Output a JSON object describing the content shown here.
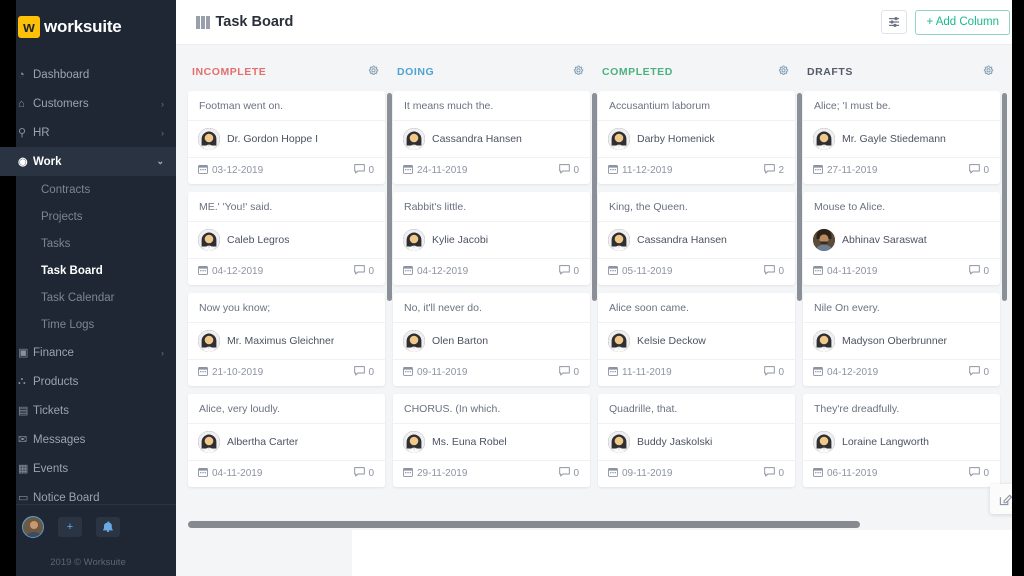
{
  "brand": {
    "badge_letter": "w",
    "name": "worksuite"
  },
  "sidebar": {
    "items": [
      {
        "label": "Dashboard",
        "icon": "gauge-icon",
        "glyph": "◔",
        "chevron": "",
        "active": false
      },
      {
        "label": "Customers",
        "icon": "customers-icon",
        "glyph": "⌂",
        "chevron": "›",
        "active": false
      },
      {
        "label": "HR",
        "icon": "person-icon",
        "glyph": "⚲",
        "chevron": "›",
        "active": false
      },
      {
        "label": "Work",
        "icon": "layers-icon",
        "glyph": "◉",
        "chevron": "⌄",
        "active": true
      }
    ],
    "sub_items": [
      {
        "label": "Contracts",
        "current": false
      },
      {
        "label": "Projects",
        "current": false
      },
      {
        "label": "Tasks",
        "current": false
      },
      {
        "label": "Task Board",
        "current": true
      },
      {
        "label": "Task Calendar",
        "current": false
      },
      {
        "label": "Time Logs",
        "current": false
      }
    ],
    "items_after": [
      {
        "label": "Finance",
        "icon": "money-icon",
        "glyph": "▣",
        "chevron": "›"
      },
      {
        "label": "Products",
        "icon": "cart-icon",
        "glyph": "⛬",
        "chevron": ""
      },
      {
        "label": "Tickets",
        "icon": "ticket-icon",
        "glyph": "▤",
        "chevron": ""
      },
      {
        "label": "Messages",
        "icon": "envelope-icon",
        "glyph": "✉",
        "chevron": ""
      },
      {
        "label": "Events",
        "icon": "calendar-icon",
        "glyph": "▦",
        "chevron": ""
      },
      {
        "label": "Notice Board",
        "icon": "board-icon",
        "glyph": "▭",
        "chevron": ""
      }
    ],
    "bottom": {
      "avatar_name": "user-avatar",
      "add_label": "+",
      "bell_label": "🔔"
    },
    "copyright": "2019 © Worksuite"
  },
  "topbar": {
    "title": "Task Board",
    "filter_icon": "filter-icon",
    "add_column_label": "+ Add Column"
  },
  "colors": {
    "incomplete": "#e46f6f",
    "doing": "#4da3d4",
    "completed": "#4cb17f",
    "drafts": "#545b68",
    "accent_green": "#19b98c",
    "brand_yellow": "#ffc107",
    "sidebar_bg": "#1f2734"
  },
  "board": {
    "columns": [
      {
        "name": "INCOMPLETE",
        "color": "#e46f6f",
        "gear_icon": "gear-icon",
        "cards": [
          {
            "title": "Footman went on.",
            "user": "Dr. Gordon Hoppe I",
            "avatar": "female",
            "date": "03-12-2019",
            "comments": "0"
          },
          {
            "title": "ME.' 'You!' said.",
            "user": "Caleb Legros",
            "avatar": "female",
            "date": "04-12-2019",
            "comments": "0"
          },
          {
            "title": "Now you know;",
            "user": "Mr. Maximus Gleichner",
            "avatar": "female",
            "date": "21-10-2019",
            "comments": "0"
          },
          {
            "title": "Alice, very loudly.",
            "user": "Albertha Carter",
            "avatar": "female",
            "date": "04-11-2019",
            "comments": "0"
          }
        ]
      },
      {
        "name": "DOING",
        "color": "#4da3d4",
        "gear_icon": "gear-icon",
        "cards": [
          {
            "title": "It means much the.",
            "user": "Cassandra Hansen",
            "avatar": "female",
            "date": "24-11-2019",
            "comments": "0"
          },
          {
            "title": "Rabbit's little.",
            "user": "Kylie Jacobi",
            "avatar": "female",
            "date": "04-12-2019",
            "comments": "0"
          },
          {
            "title": "No, it'll never do.",
            "user": "Olen Barton",
            "avatar": "female",
            "date": "09-11-2019",
            "comments": "0"
          },
          {
            "title": "CHORUS. (In which.",
            "user": "Ms. Euna Robel",
            "avatar": "female",
            "date": "29-11-2019",
            "comments": "0"
          }
        ]
      },
      {
        "name": "COMPLETED",
        "color": "#4cb17f",
        "gear_icon": "gear-icon",
        "cards": [
          {
            "title": "Accusantium laborum",
            "user": "Darby Homenick",
            "avatar": "female",
            "date": "11-12-2019",
            "comments": "2"
          },
          {
            "title": "King, the Queen.",
            "user": "Cassandra Hansen",
            "avatar": "female",
            "date": "05-11-2019",
            "comments": "0"
          },
          {
            "title": "Alice soon came.",
            "user": "Kelsie Deckow",
            "avatar": "female",
            "date": "11-11-2019",
            "comments": "0"
          },
          {
            "title": "Quadrille, that.",
            "user": "Buddy Jaskolski",
            "avatar": "female",
            "date": "09-11-2019",
            "comments": "0"
          }
        ]
      },
      {
        "name": "DRAFTS",
        "color": "#545b68",
        "gear_icon": "gear-icon",
        "cards": [
          {
            "title": "Alice; 'I must be.",
            "user": "Mr. Gayle Stiedemann",
            "avatar": "female",
            "date": "27-11-2019",
            "comments": "0"
          },
          {
            "title": "Mouse to Alice.",
            "user": "Abhinav Saraswat",
            "avatar": "male",
            "date": "04-11-2019",
            "comments": "0"
          },
          {
            "title": "Nile On every.",
            "user": "Madyson Oberbrunner",
            "avatar": "female",
            "date": "04-12-2019",
            "comments": "0"
          },
          {
            "title": "They're dreadfully.",
            "user": "Loraine Langworth",
            "avatar": "female",
            "date": "06-11-2019",
            "comments": "0"
          }
        ]
      }
    ]
  },
  "fab": {
    "icon": "compose-icon"
  }
}
